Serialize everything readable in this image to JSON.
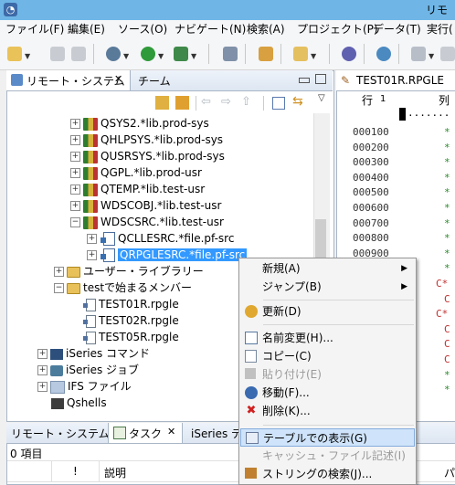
{
  "window": {
    "title": "リモ"
  },
  "menubar": [
    "ファイル(F)",
    "編集(E)",
    "ソース(O)",
    "ナビゲート(N)",
    "検索(A)",
    "プロジェクト(P)",
    "データ(T)",
    "実行("
  ],
  "left_view": {
    "tabs": [
      "リモート・システム",
      "チーム"
    ],
    "tree": [
      {
        "label": "QSYS2.*lib.prod-sys",
        "type": "library"
      },
      {
        "label": "QHLPSYS.*lib.prod-sys",
        "type": "library"
      },
      {
        "label": "QUSRSYS.*lib.prod-sys",
        "type": "library"
      },
      {
        "label": "QGPL.*lib.prod-usr",
        "type": "library"
      },
      {
        "label": "QTEMP.*lib.test-usr",
        "type": "library"
      },
      {
        "label": "WDSCOBJ.*lib.test-usr",
        "type": "library"
      },
      {
        "label": "WDSCSRC.*lib.test-usr",
        "type": "library"
      },
      {
        "label": "QCLLESRC.*file.pf-src",
        "type": "file"
      },
      {
        "label": "QRPGLESRC.*file.pf-src",
        "type": "file",
        "selected": true
      },
      {
        "label": "ユーザー・ライブラリー",
        "type": "folder"
      },
      {
        "label": "testで始まるメンバー",
        "type": "filter"
      },
      {
        "label": "TEST01R.rpgle",
        "type": "member"
      },
      {
        "label": "TEST02R.rpgle",
        "type": "member"
      },
      {
        "label": "TEST05R.rpgle",
        "type": "member"
      },
      {
        "label": "iSeries コマンド",
        "type": "commands"
      },
      {
        "label": "iSeries ジョブ",
        "type": "jobs"
      },
      {
        "label": "IFS ファイル",
        "type": "ifs"
      },
      {
        "label": "Qshells",
        "type": "shell"
      }
    ]
  },
  "editor": {
    "tab": "TEST01R.RPGLE",
    "ruler_row": "行",
    "ruler_num": "1",
    "ruler_col": "列",
    "ruler_dots": ".......",
    "lines": [
      {
        "seq": "000100",
        "mark": "*",
        "color": "#2a8a2a"
      },
      {
        "seq": "000200",
        "mark": "*",
        "color": "#2a8a2a"
      },
      {
        "seq": "000300",
        "mark": "*",
        "color": "#2a8a2a"
      },
      {
        "seq": "000400",
        "mark": "*",
        "color": "#2a8a2a"
      },
      {
        "seq": "000500",
        "mark": "*",
        "color": "#2a8a2a"
      },
      {
        "seq": "000600",
        "mark": "*",
        "color": "#2a8a2a"
      },
      {
        "seq": "000700",
        "mark": "*",
        "color": "#2a8a2a"
      },
      {
        "seq": "000800",
        "mark": "*",
        "color": "#2a8a2a"
      },
      {
        "seq": "000900",
        "mark": "*",
        "color": "#2a8a2a"
      },
      {
        "seq": "",
        "mark": "*",
        "color": "#2a8a2a"
      },
      {
        "seq": "",
        "mark": "C*",
        "color": "#c03030"
      },
      {
        "seq": "",
        "mark": "C",
        "color": "#c03030"
      },
      {
        "seq": "",
        "mark": "C*",
        "color": "#c03030"
      },
      {
        "seq": "",
        "mark": "C",
        "color": "#c03030"
      },
      {
        "seq": "",
        "mark": "C",
        "color": "#c03030"
      },
      {
        "seq": "",
        "mark": "C",
        "color": "#c03030"
      },
      {
        "seq": "",
        "mark": "*",
        "color": "#2a8a2a"
      },
      {
        "seq": "",
        "mark": "*",
        "color": "#2a8a2a"
      }
    ]
  },
  "bottom_view": {
    "tabs": [
      "リモート・システム詳細",
      "タスク",
      "iSeries テ"
    ],
    "count": "0 項目",
    "columns": [
      "!",
      "説明",
      "パ"
    ]
  },
  "context_menu": {
    "items": [
      {
        "label": "新規(A)",
        "submenu": true,
        "icon": "none",
        "disabled": false,
        "highlight": false
      },
      {
        "label": "ジャンプ(B)",
        "submenu": true,
        "icon": "none",
        "disabled": false,
        "highlight": false
      },
      {
        "label": "更新(D)",
        "submenu": false,
        "icon": "refresh-icon",
        "disabled": false,
        "highlight": false
      },
      {
        "label": "名前変更(H)...",
        "submenu": false,
        "icon": "rename-icon",
        "disabled": false,
        "highlight": false
      },
      {
        "label": "コピー(C)",
        "submenu": false,
        "icon": "copy-icon",
        "disabled": false,
        "highlight": false
      },
      {
        "label": "貼り付け(E)",
        "submenu": false,
        "icon": "paste-icon",
        "disabled": true,
        "highlight": false
      },
      {
        "label": "移動(F)...",
        "submenu": false,
        "icon": "move-icon",
        "disabled": false,
        "highlight": false
      },
      {
        "label": "削除(K)...",
        "submenu": false,
        "icon": "delete-icon",
        "disabled": false,
        "highlight": false
      },
      {
        "label": "テーブルでの表示(G)",
        "submenu": false,
        "icon": "table-icon",
        "disabled": false,
        "highlight": true
      },
      {
        "label": "キャッシュ・ファイル記述(I)",
        "submenu": false,
        "icon": "none",
        "disabled": true,
        "highlight": false
      },
      {
        "label": "ストリングの検索(J)...",
        "submenu": false,
        "icon": "search-string-icon",
        "disabled": false,
        "highlight": false
      }
    ]
  }
}
